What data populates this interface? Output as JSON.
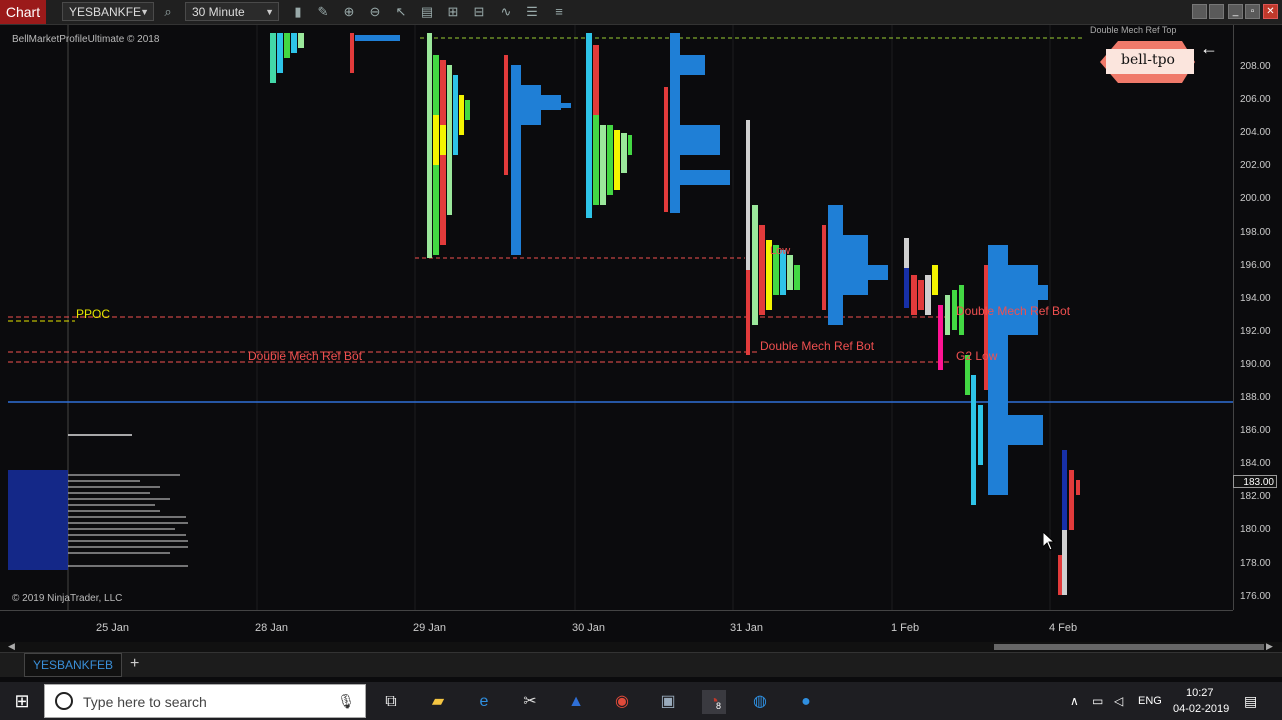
{
  "toolbar": {
    "chart_label": "Chart",
    "instrument": "YESBANKFE",
    "interval": "30 Minute"
  },
  "chart": {
    "copyright_top": "BellMarketProfileUltimate © 2018",
    "copyright_bottom": "© 2019 NinjaTrader, LLC",
    "logo_text": "bell-tpo",
    "panel_label": "F",
    "top_right_label": "Double Mech Ref Top",
    "price_labels": [
      "208.00",
      "206.00",
      "204.00",
      "202.00",
      "200.00",
      "198.00",
      "196.00",
      "194.00",
      "192.00",
      "190.00",
      "188.00",
      "186.00",
      "184.00",
      "182.00",
      "180.00",
      "178.00",
      "176.00"
    ],
    "current_price": "183.00",
    "date_labels": [
      "25 Jan",
      "28 Jan",
      "29 Jan",
      "30 Jan",
      "31 Jan",
      "1 Feb",
      "4 Feb"
    ],
    "annotations": {
      "ppoc": "PPOC",
      "double_mech_1": "Double Mech Ref Bot",
      "double_mech_2": "Double Mech Ref Bot",
      "double_mech_3": "Double Mech Ref Bot",
      "g2_low": "G2 Low",
      "low_label": "Low"
    },
    "colors": {
      "blue_line": "#2f6fd6",
      "profile_blue": "#1f7fd6",
      "red": "#e23b3b",
      "yellow": "#f4f400",
      "green": "#43d843",
      "ppoc": "#e6e600",
      "annotation_red": "#f05050"
    }
  },
  "tabs": {
    "active": "YESBANKFEB"
  },
  "taskbar": {
    "search_placeholder": "Type here to search",
    "language": "ENG",
    "time": "10:27",
    "date": "04-02-2019",
    "badge": "8"
  }
}
